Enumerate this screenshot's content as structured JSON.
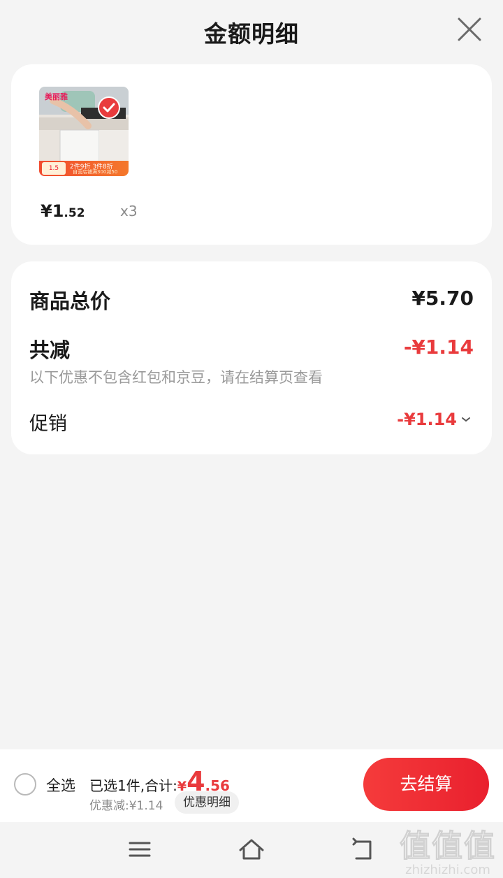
{
  "header": {
    "title": "金额明细"
  },
  "product": {
    "image_brand": "美丽雅",
    "image_promo_line1": "2件9折 3件8折",
    "image_promo_line2": "自营店铺满300减50",
    "image_price": "1.5",
    "price_int": "¥1",
    "price_dec": ".52",
    "quantity": "x3"
  },
  "summary": {
    "total_label": "商品总价",
    "total_value": "¥5.70",
    "reduce_label": "共减",
    "reduce_value": "-¥1.14",
    "note": "以下优惠不包含红包和京豆，请在结算页查看",
    "promo_label": "促销",
    "promo_value": "-¥1.14"
  },
  "bottom": {
    "select_all": "全选",
    "selected_text": "已选1件,合计:",
    "total_yen": "¥",
    "total_int": "4",
    "total_dec": ".56",
    "discount_text": "优惠减:¥1.14",
    "detail_btn": "优惠明细",
    "checkout_btn": "去结算"
  },
  "watermark": {
    "big": "值值值",
    "small": "zhizhizhi.com"
  },
  "colors": {
    "accent": "#e93b3d",
    "background": "#f4f4f4",
    "muted": "#9a9a9a"
  },
  "icons": {
    "close": "close-icon",
    "check": "check-icon",
    "chevron": "chevron-down-icon",
    "menu": "menu-icon",
    "home": "home-icon",
    "back": "back-icon"
  }
}
